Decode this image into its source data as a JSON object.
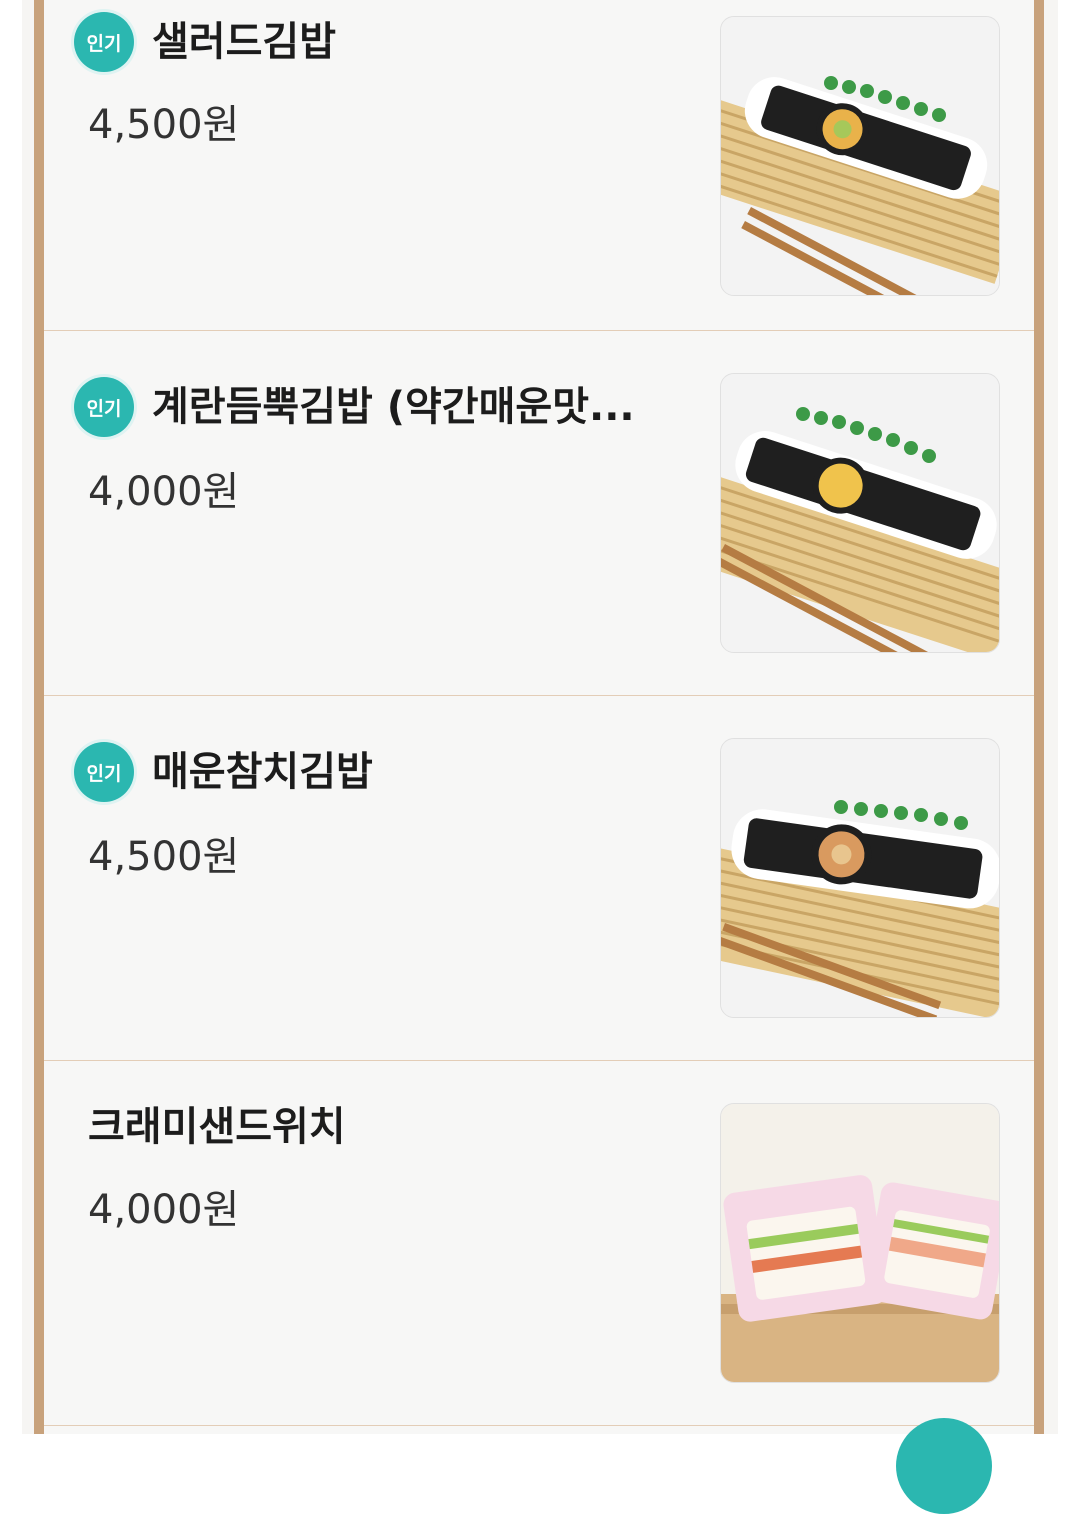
{
  "menu": {
    "items": [
      {
        "badge": "인기",
        "name": "샐러드김밥",
        "price": "4,500원"
      },
      {
        "badge": "인기",
        "name": "계란듬뿍김밥 (약간매운맛...",
        "price": "4,000원"
      },
      {
        "badge": "인기",
        "name": "매운참치김밥",
        "price": "4,500원"
      },
      {
        "badge": "",
        "name": "크래미샌드위치",
        "price": "4,000원"
      }
    ]
  },
  "colors": {
    "accent": "#2bb7b0",
    "frame": "#c8a27c",
    "divider": "#e3cdb7"
  }
}
